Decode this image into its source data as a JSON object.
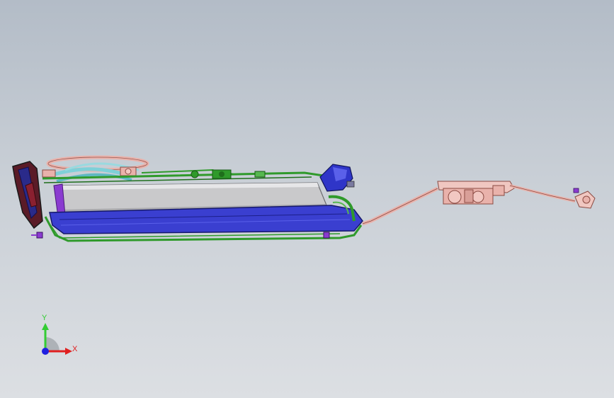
{
  "viewport": {
    "background_top": "#b3bcc7",
    "background_bottom": "#dcdfe3"
  },
  "model": {
    "colors": {
      "green": "#2f9a2b",
      "blue": "#2f35c8",
      "gray_panel": "#c9c9cb",
      "pink": "#e9b2ab",
      "cyan": "#7fd0d8",
      "purple": "#8a3bd0",
      "dark_red": "#6b1e2a"
    }
  },
  "triad": {
    "y_label": "Y",
    "x_label": "X",
    "y_color": "#33cc33",
    "x_color": "#e02020",
    "z_color": "#2020e0"
  }
}
